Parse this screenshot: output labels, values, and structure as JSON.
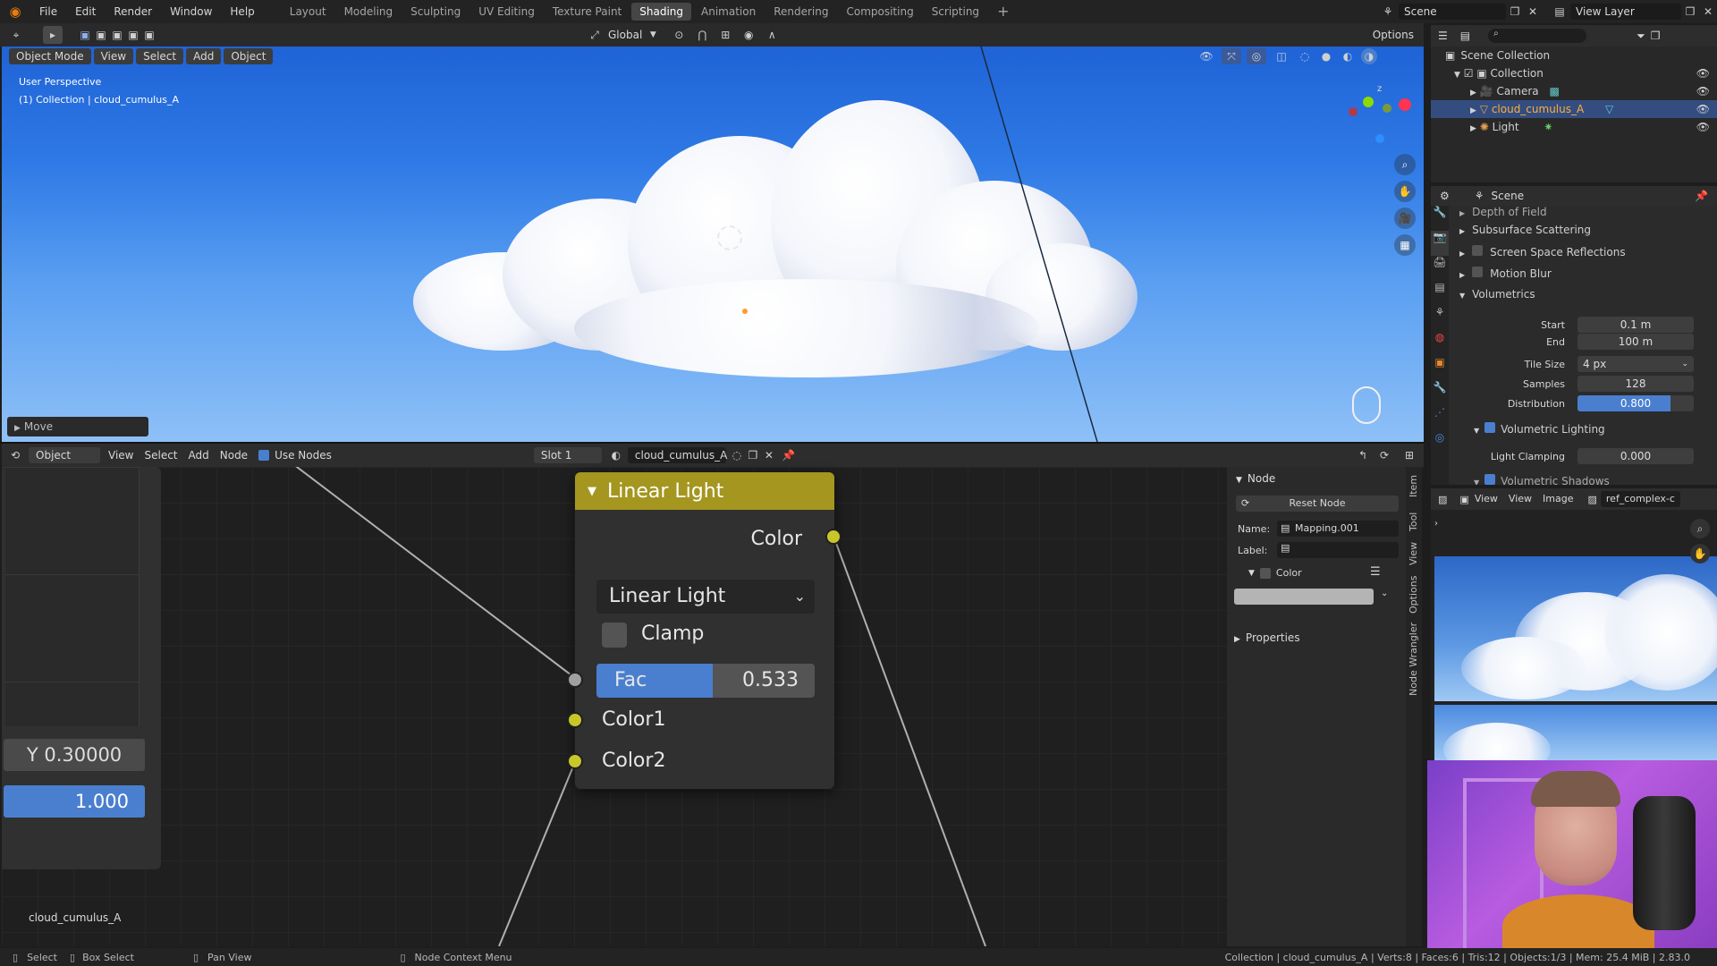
{
  "topbar": {
    "menu": [
      "File",
      "Edit",
      "Render",
      "Window",
      "Help"
    ],
    "workspaces": [
      "Layout",
      "Modeling",
      "Sculpting",
      "UV Editing",
      "Texture Paint",
      "Shading",
      "Animation",
      "Rendering",
      "Compositing",
      "Scripting"
    ],
    "active_workspace": "Shading",
    "plus": "+",
    "scene_label": "Scene",
    "view_layer_label": "View Layer"
  },
  "viewport_header": {
    "mode": "Object Mode",
    "menus": [
      "View",
      "Select",
      "Add",
      "Object"
    ],
    "transform": "Global",
    "options": "Options"
  },
  "viewport": {
    "perspective": "User Perspective",
    "collection_info": "(1) Collection | cloud_cumulus_A",
    "last_op": "Move"
  },
  "node_header": {
    "type": "Object",
    "menus": [
      "View",
      "Select",
      "Add",
      "Node"
    ],
    "use_nodes_label": "Use Nodes",
    "slot": "Slot 1",
    "material": "cloud_cumulus_A"
  },
  "node": {
    "title": "Linear Light",
    "output_label": "Color",
    "blend_mode": "Linear Light",
    "clamp_label": "Clamp",
    "fac_label": "Fac",
    "fac_value": "0.533",
    "fac_fraction": 0.533,
    "input1": "Color1",
    "input2": "Color2",
    "header_color": "#a4961f",
    "socket_color": "#c7c72a"
  },
  "left_node": {
    "y_value": "Y 0.30000",
    "value": "1.000"
  },
  "node_editor_footer": "cloud_cumulus_A",
  "node_sidebar": {
    "section": "Node",
    "reset": "Reset Node",
    "name_label": "Name:",
    "name_value": "Mapping.001",
    "label_label": "Label:",
    "color_label": "Color",
    "properties_label": "Properties",
    "tabs": [
      "Item",
      "Tool",
      "View",
      "Options",
      "Node Wrangler"
    ]
  },
  "outliner": {
    "root": "Scene Collection",
    "items": [
      "Collection",
      "Camera",
      "cloud_cumulus_A",
      "Light"
    ]
  },
  "properties": {
    "scene_label": "Scene",
    "items": {
      "dof": "Depth of Field",
      "sss": "Subsurface Scattering",
      "ssr": "Screen Space Reflections",
      "motion_blur": "Motion Blur",
      "volumetrics": "Volumetrics",
      "start_label": "Start",
      "start_value": "0.1 m",
      "end_label": "End",
      "end_value": "100 m",
      "tile_label": "Tile Size",
      "tile_value": "4 px",
      "samples_label": "Samples",
      "samples_value": "128",
      "dist_label": "Distribution",
      "dist_value": "0.800",
      "dist_fraction": 0.8,
      "vol_light": "Volumetric Lighting",
      "light_clamp_label": "Light Clamping",
      "light_clamp_value": "0.000",
      "vol_shadows": "Volumetric Shadows"
    }
  },
  "image_editor": {
    "menus": [
      "View",
      "View",
      "Image"
    ],
    "image_name": "ref_complex-c"
  },
  "statusbar": {
    "select": "Select",
    "box_select": "Box Select",
    "pan_view": "Pan View",
    "context_menu": "Node Context Menu",
    "stats": "Collection | cloud_cumulus_A | Verts:8 | Faces:6 | Tris:12 | Objects:1/3 | Mem: 25.4 MiB | 2.83.0"
  }
}
